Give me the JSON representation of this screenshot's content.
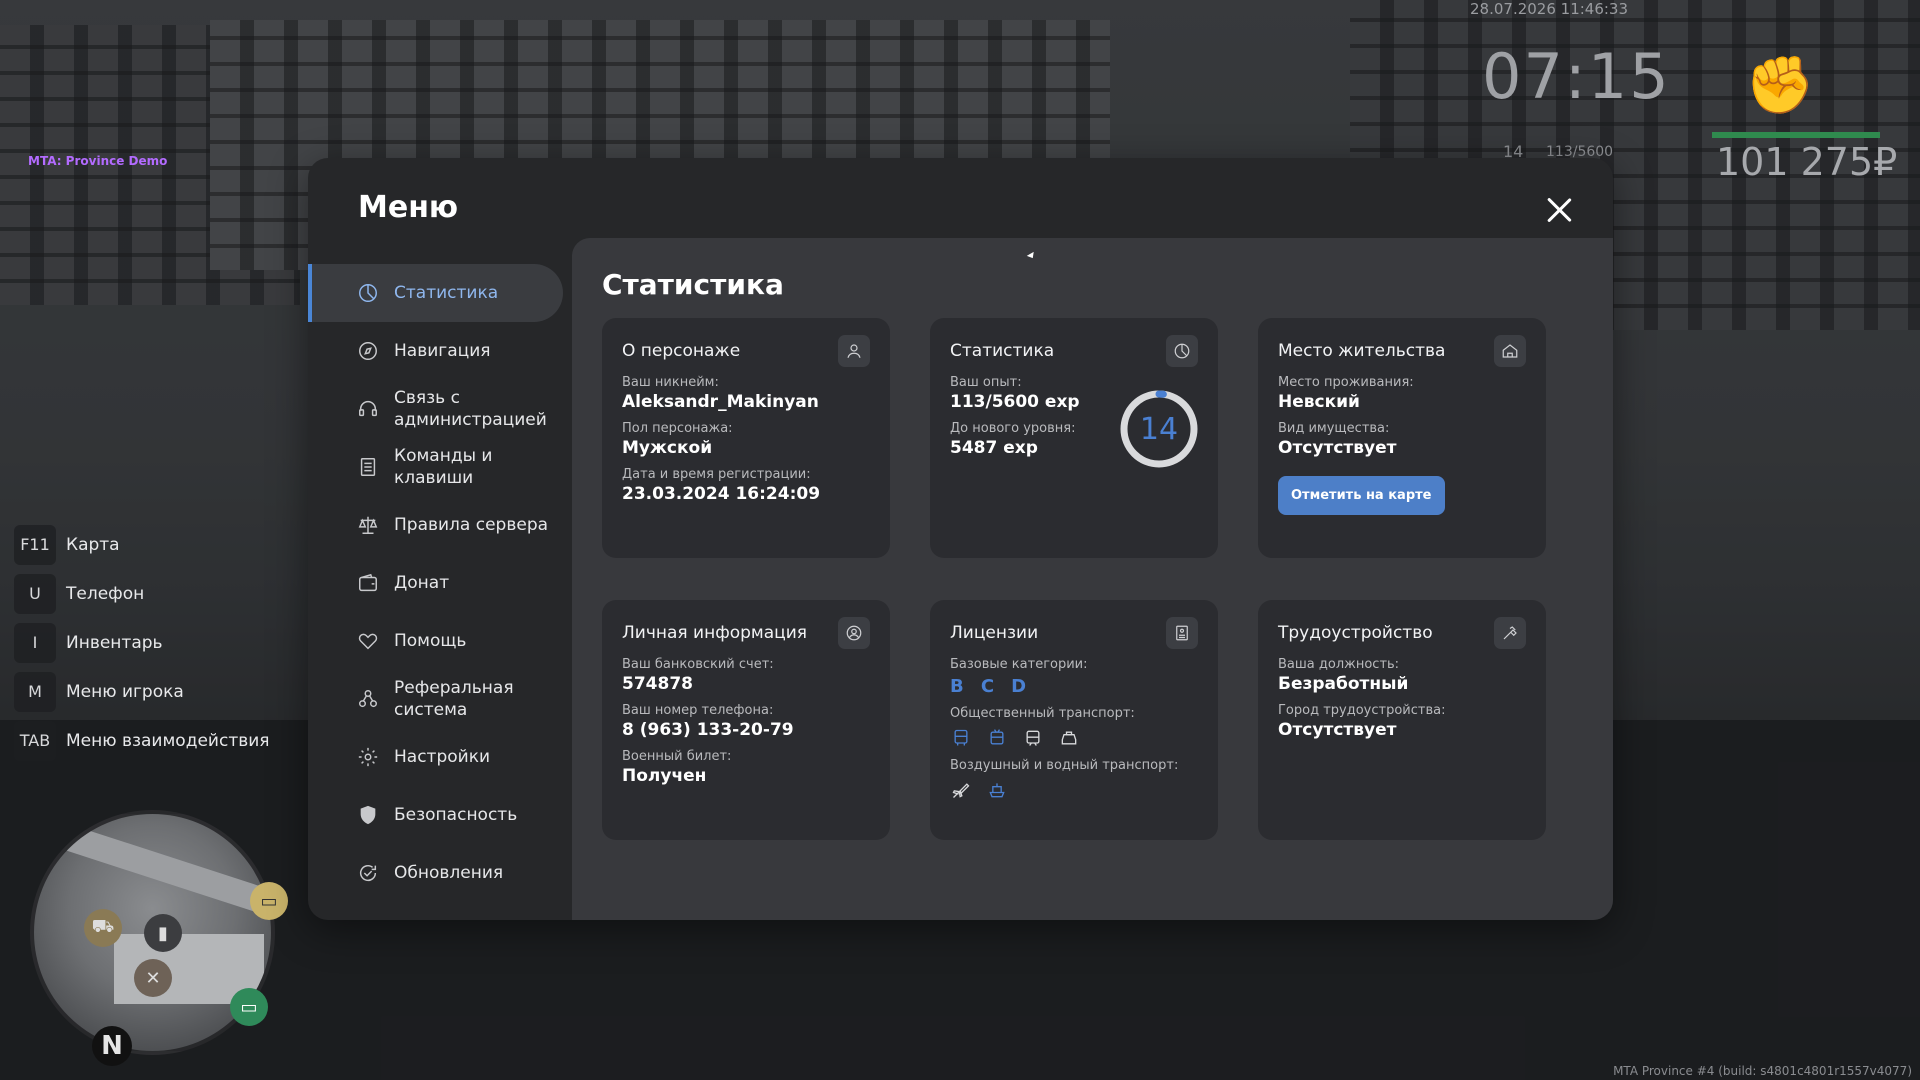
{
  "hud": {
    "server_name": "MTA: Province Demo",
    "datetime": "28.07.2026 11:46:33",
    "time": "07:15",
    "level": "14",
    "exp": "113/5600",
    "money": "101 275₽",
    "build": "MTA Province #4 (build: s4801c4801r1557v4077)"
  },
  "hotkeys": [
    {
      "key": "F11",
      "label": "Карта"
    },
    {
      "key": "U",
      "label": "Телефон"
    },
    {
      "key": "I",
      "label": "Инвентарь"
    },
    {
      "key": "M",
      "label": "Меню игрока"
    },
    {
      "key": "TAB",
      "label": "Меню взаимодействия"
    }
  ],
  "minimap": {
    "north": "N"
  },
  "menu": {
    "title": "Меню",
    "nav": [
      {
        "label": "Статистика",
        "icon": "pie-chart-icon",
        "active": true
      },
      {
        "label": "Навигация",
        "icon": "compass-icon"
      },
      {
        "label": "Связь с администрацией",
        "icon": "headset-icon"
      },
      {
        "label": "Команды и клавиши",
        "icon": "list-icon"
      },
      {
        "label": "Правила сервера",
        "icon": "scales-icon"
      },
      {
        "label": "Донат",
        "icon": "wallet-icon"
      },
      {
        "label": "Помощь",
        "icon": "handshake-icon"
      },
      {
        "label": "Реферальная система",
        "icon": "referral-icon"
      },
      {
        "label": "Настройки",
        "icon": "gear-icon"
      },
      {
        "label": "Безопасность",
        "icon": "shield-icon"
      },
      {
        "label": "Обновления",
        "icon": "refresh-check-icon"
      }
    ],
    "accent_color": "#4a80d2"
  },
  "stats": {
    "title": "Статистика",
    "character": {
      "title": "О персонаже",
      "nickname_label": "Ваш никнейм:",
      "nickname": "Aleksandr_Makinyan",
      "gender_label": "Пол персонажа:",
      "gender": "Мужской",
      "reg_label": "Дата и время регистрации:",
      "reg_date": "23.03.2024 16:24:09"
    },
    "statistics": {
      "title": "Статистика",
      "exp_label": "Ваш опыт:",
      "exp": "113/5600 exp",
      "next_label": "До нового уровня:",
      "next": "5487 exp",
      "level": "14",
      "progress": 0.02
    },
    "residence": {
      "title": "Место жительства",
      "place_label": "Место проживания:",
      "place": "Невский",
      "property_label": "Вид имущества:",
      "property": "Отсутствует",
      "button": "Отметить на карте"
    },
    "personal": {
      "title": "Личная информация",
      "bank_label": "Ваш банковский счет:",
      "bank": "574878",
      "phone_label": "Ваш номер телефона:",
      "phone": "8 (963) 133-20-79",
      "military_label": "Военный билет:",
      "military": "Получен"
    },
    "licenses": {
      "title": "Лицензии",
      "base_label": "Базовые категории:",
      "categories": [
        "B",
        "C",
        "D"
      ],
      "public_label": "Общественный транспорт:",
      "air_label": "Воздушный и водный транспорт:"
    },
    "employment": {
      "title": "Трудоустройство",
      "position_label": "Ваша должность:",
      "position": "Безработный",
      "city_label": "Город трудоустройства:",
      "city": "Отсутствует"
    }
  }
}
